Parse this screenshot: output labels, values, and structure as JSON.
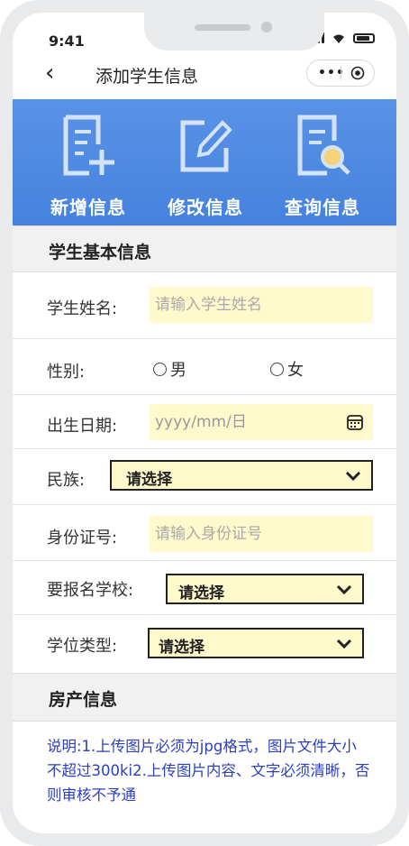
{
  "status": {
    "time": "9:41"
  },
  "nav": {
    "title": "添加学生信息",
    "back_icon": "chevron-left-icon",
    "more_label": "•••"
  },
  "actions": [
    {
      "label": "新增信息",
      "icon": "add-document-icon"
    },
    {
      "label": "修改信息",
      "icon": "edit-icon"
    },
    {
      "label": "查询信息",
      "icon": "search-document-icon"
    }
  ],
  "sections": {
    "basic": "学生基本信息",
    "property": "房产信息"
  },
  "form": {
    "name": {
      "label": "学生姓名:",
      "placeholder": "请输入学生姓名"
    },
    "gender": {
      "label": "性别:",
      "options": [
        "男",
        "女"
      ]
    },
    "birth": {
      "label": "出生日期:",
      "placeholder": "yyyy/mm/日"
    },
    "ethnicity": {
      "label": "民族:",
      "value": "请选择"
    },
    "idcard": {
      "label": "身份证号:",
      "placeholder": "请输入身份证号"
    },
    "school": {
      "label": "要报名学校:",
      "value": "请选择"
    },
    "degree": {
      "label": "学位类型:",
      "value": "请选择"
    }
  },
  "note": "说明:1.上传图片必须为jpg格式，图片文件大小不超过300ki2.上传图片内容、文字必须清晰，否则审核不予通",
  "colors": {
    "banner": "#4a86e0",
    "input_bg": "#fff9cc",
    "note_text": "#2b3fbf"
  }
}
